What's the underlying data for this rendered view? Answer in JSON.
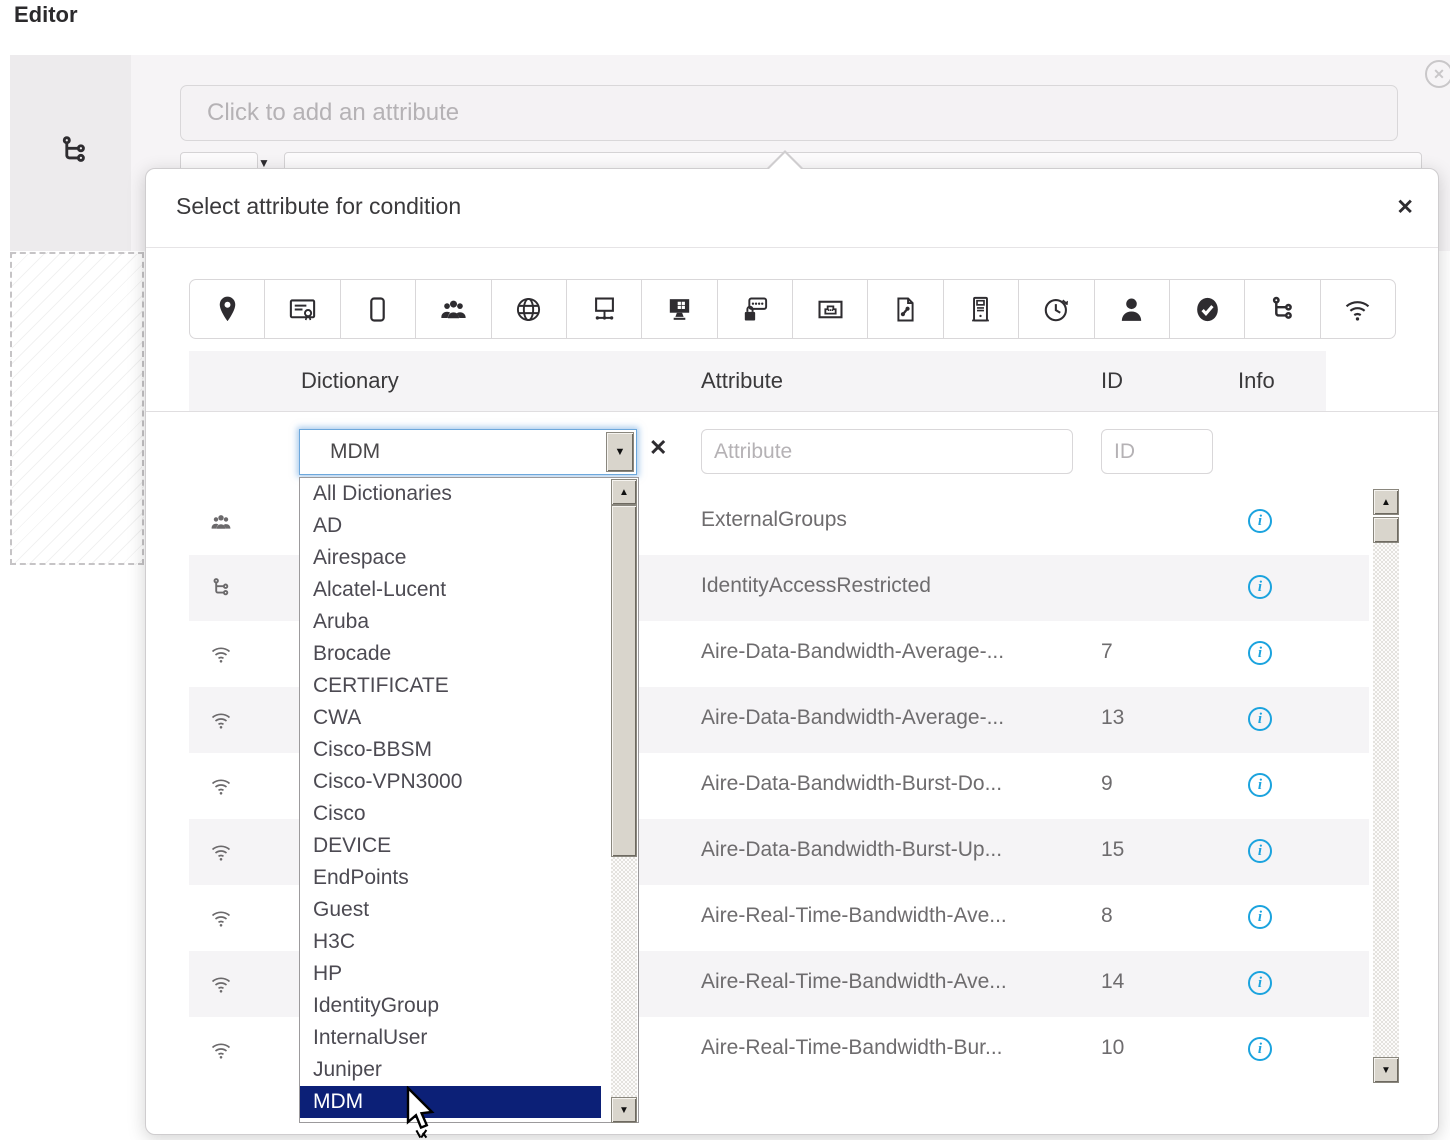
{
  "page": {
    "heading": "Editor"
  },
  "editor_panel": {
    "attribute_input_placeholder": "Click to add an attribute"
  },
  "dialog": {
    "title": "Select attribute for condition",
    "toolbar_icons": [
      "location",
      "certificate",
      "endpoint-device",
      "identity-groups",
      "internet-domain",
      "network-access",
      "workstation",
      "password",
      "ethernet-port",
      "policy-file",
      "server",
      "time-and-date",
      "user",
      "posture-status",
      "network-condition",
      "wireless"
    ],
    "table": {
      "columns": {
        "dictionary": "Dictionary",
        "attribute": "Attribute",
        "id": "ID",
        "info": "Info"
      },
      "filter": {
        "dictionary_value": "MDM",
        "attribute_placeholder": "Attribute",
        "id_placeholder": "ID"
      },
      "rows": [
        {
          "icon": "identity-groups",
          "attribute": "ExternalGroups",
          "id": ""
        },
        {
          "icon": "network-condition",
          "attribute": "IdentityAccessRestricted",
          "id": ""
        },
        {
          "icon": "wireless",
          "attribute": "Aire-Data-Bandwidth-Average-...",
          "id": "7"
        },
        {
          "icon": "wireless",
          "attribute": "Aire-Data-Bandwidth-Average-...",
          "id": "13"
        },
        {
          "icon": "wireless",
          "attribute": "Aire-Data-Bandwidth-Burst-Do...",
          "id": "9"
        },
        {
          "icon": "wireless",
          "attribute": "Aire-Data-Bandwidth-Burst-Up...",
          "id": "15"
        },
        {
          "icon": "wireless",
          "attribute": "Aire-Real-Time-Bandwidth-Ave...",
          "id": "8"
        },
        {
          "icon": "wireless",
          "attribute": "Aire-Real-Time-Bandwidth-Ave...",
          "id": "14"
        },
        {
          "icon": "wireless",
          "attribute": "Aire-Real-Time-Bandwidth-Bur...",
          "id": "10"
        }
      ]
    },
    "dictionary_dropdown": {
      "items": [
        "All Dictionaries",
        "AD",
        "Airespace",
        "Alcatel-Lucent",
        "Aruba",
        "Brocade",
        "CERTIFICATE",
        "CWA",
        "Cisco-BBSM",
        "Cisco-VPN3000",
        "Cisco",
        "DEVICE",
        "EndPoints",
        "Guest",
        "H3C",
        "HP",
        "IdentityGroup",
        "InternalUser",
        "Juniper",
        "MDM"
      ],
      "selected_item": "MDM"
    }
  },
  "glyphs": {
    "close": "✕",
    "clear_filter": "✕",
    "remove_circle": "✕",
    "caret_down": "▼",
    "scroll_up": "▲",
    "scroll_down": "▼",
    "info": "i"
  },
  "colors": {
    "accent_blue": "#1ba3de",
    "selection_navy": "#0c2077",
    "panel_gray": "#f6f4f6",
    "row_stripe": "#f5f4f6",
    "icon_dark": "#2e2c30"
  }
}
